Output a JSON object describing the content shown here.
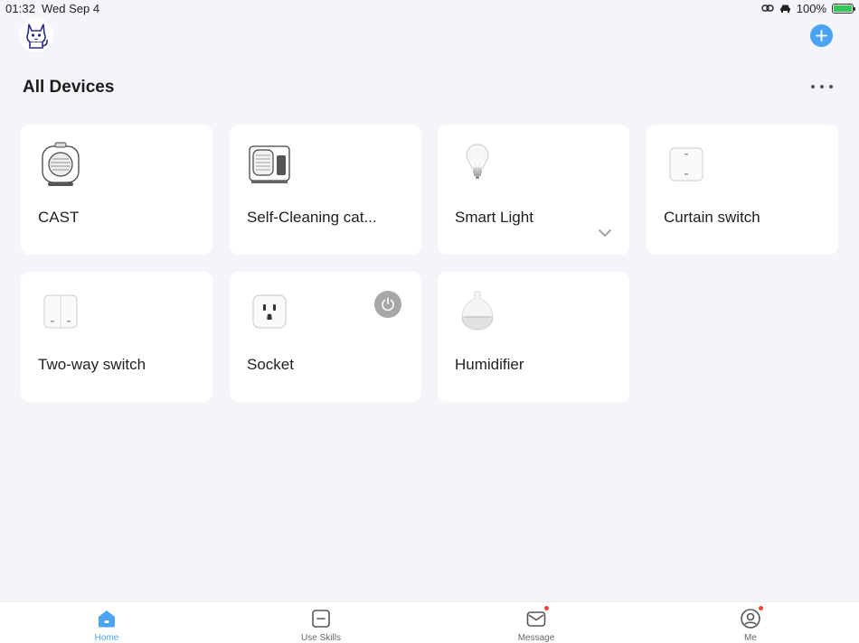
{
  "status_bar": {
    "time": "01:32",
    "date": "Wed Sep 4",
    "battery": "100%"
  },
  "header": {
    "title": "All Devices",
    "add_icon": "plus-icon",
    "more_icon": "more-dots-icon"
  },
  "devices": [
    {
      "name": "CAST",
      "icon": "cat-feeder-icon"
    },
    {
      "name": "Self-Cleaning cat...",
      "icon": "litter-box-icon"
    },
    {
      "name": "Smart Light",
      "icon": "light-bulb-icon"
    },
    {
      "name": "Curtain switch",
      "icon": "wall-switch-icon"
    },
    {
      "name": "Two-way switch",
      "icon": "double-switch-icon"
    },
    {
      "name": "Socket",
      "icon": "socket-icon"
    },
    {
      "name": "Humidifier",
      "icon": "humidifier-icon"
    }
  ],
  "tabs": [
    {
      "label": "Home",
      "icon": "home-icon",
      "active": true
    },
    {
      "label": "Use Skills",
      "icon": "skills-icon",
      "active": false
    },
    {
      "label": "Message",
      "icon": "message-icon",
      "active": false,
      "badge": true
    },
    {
      "label": "Me",
      "icon": "profile-icon",
      "active": false,
      "badge": true
    }
  ],
  "colors": {
    "accent": "#4aa3f5",
    "background": "#f4f5f9",
    "card": "#ffffff",
    "badge": "#f5403a"
  }
}
